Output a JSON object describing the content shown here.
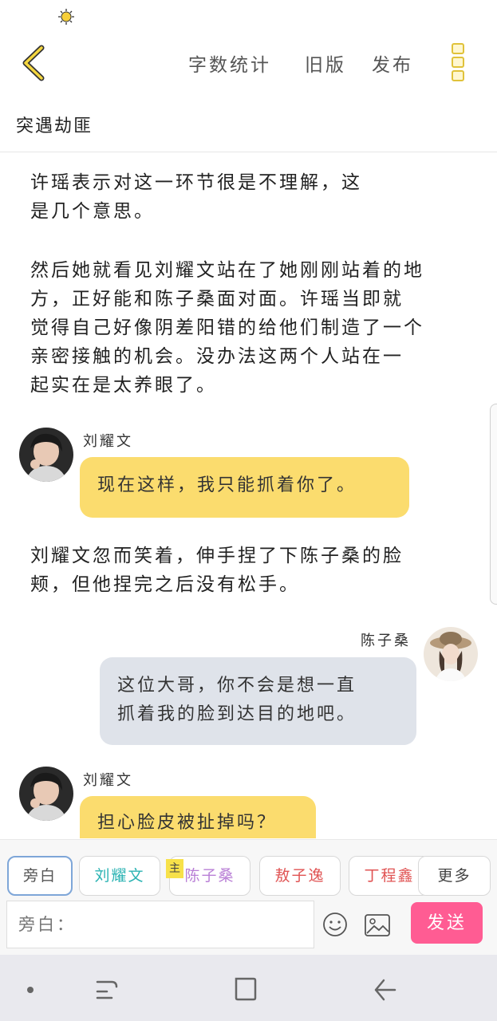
{
  "topbar": {
    "actions": [
      "字数统计",
      "旧版",
      "发布"
    ],
    "story_title": "突遇劫匪"
  },
  "content": {
    "narration_1": [
      "许瑶表示对这一环节很是不理解，这",
      "是几个意思。"
    ],
    "narration_2": [
      "然后她就看见刘耀文站在了她刚刚站着的地",
      "方，正好能和陈子桑面对面。许瑶当即就",
      "觉得自己好像阴差阳错的给他们制造了一个",
      "亲密接触的机会。没办法这两个人站在一",
      "起实在是太养眼了。"
    ],
    "message_1": {
      "speaker": "刘耀文",
      "text": "现在这样，我只能抓着你了。"
    },
    "narration_3": [
      "刘耀文忽而笑着，伸手捏了下陈子桑的脸",
      "颊，但他捏完之后没有松手。"
    ],
    "message_2": {
      "speaker": "陈子桑",
      "lines": [
        "这位大哥，你不会是想一直",
        "抓着我的脸到达目的地吧。"
      ]
    },
    "message_3": {
      "speaker": "刘耀文",
      "text": "担心脸皮被扯掉吗？"
    }
  },
  "roles": {
    "items": [
      "旁白",
      "刘耀文",
      "陈子桑",
      "敖子逸",
      "丁程鑫",
      "更多"
    ],
    "colors": [
      "#555555",
      "#2bb3b3",
      "#b97fd6",
      "#e05353",
      "#e05353",
      "#444444"
    ],
    "main_tag": "主"
  },
  "composer": {
    "placeholder": "旁白：",
    "send_label": "发送"
  },
  "colors": {
    "accent_yellow": "#fbdc6e",
    "bubble_gray": "#dfe3ea",
    "send_pink": "#ff5c93"
  }
}
